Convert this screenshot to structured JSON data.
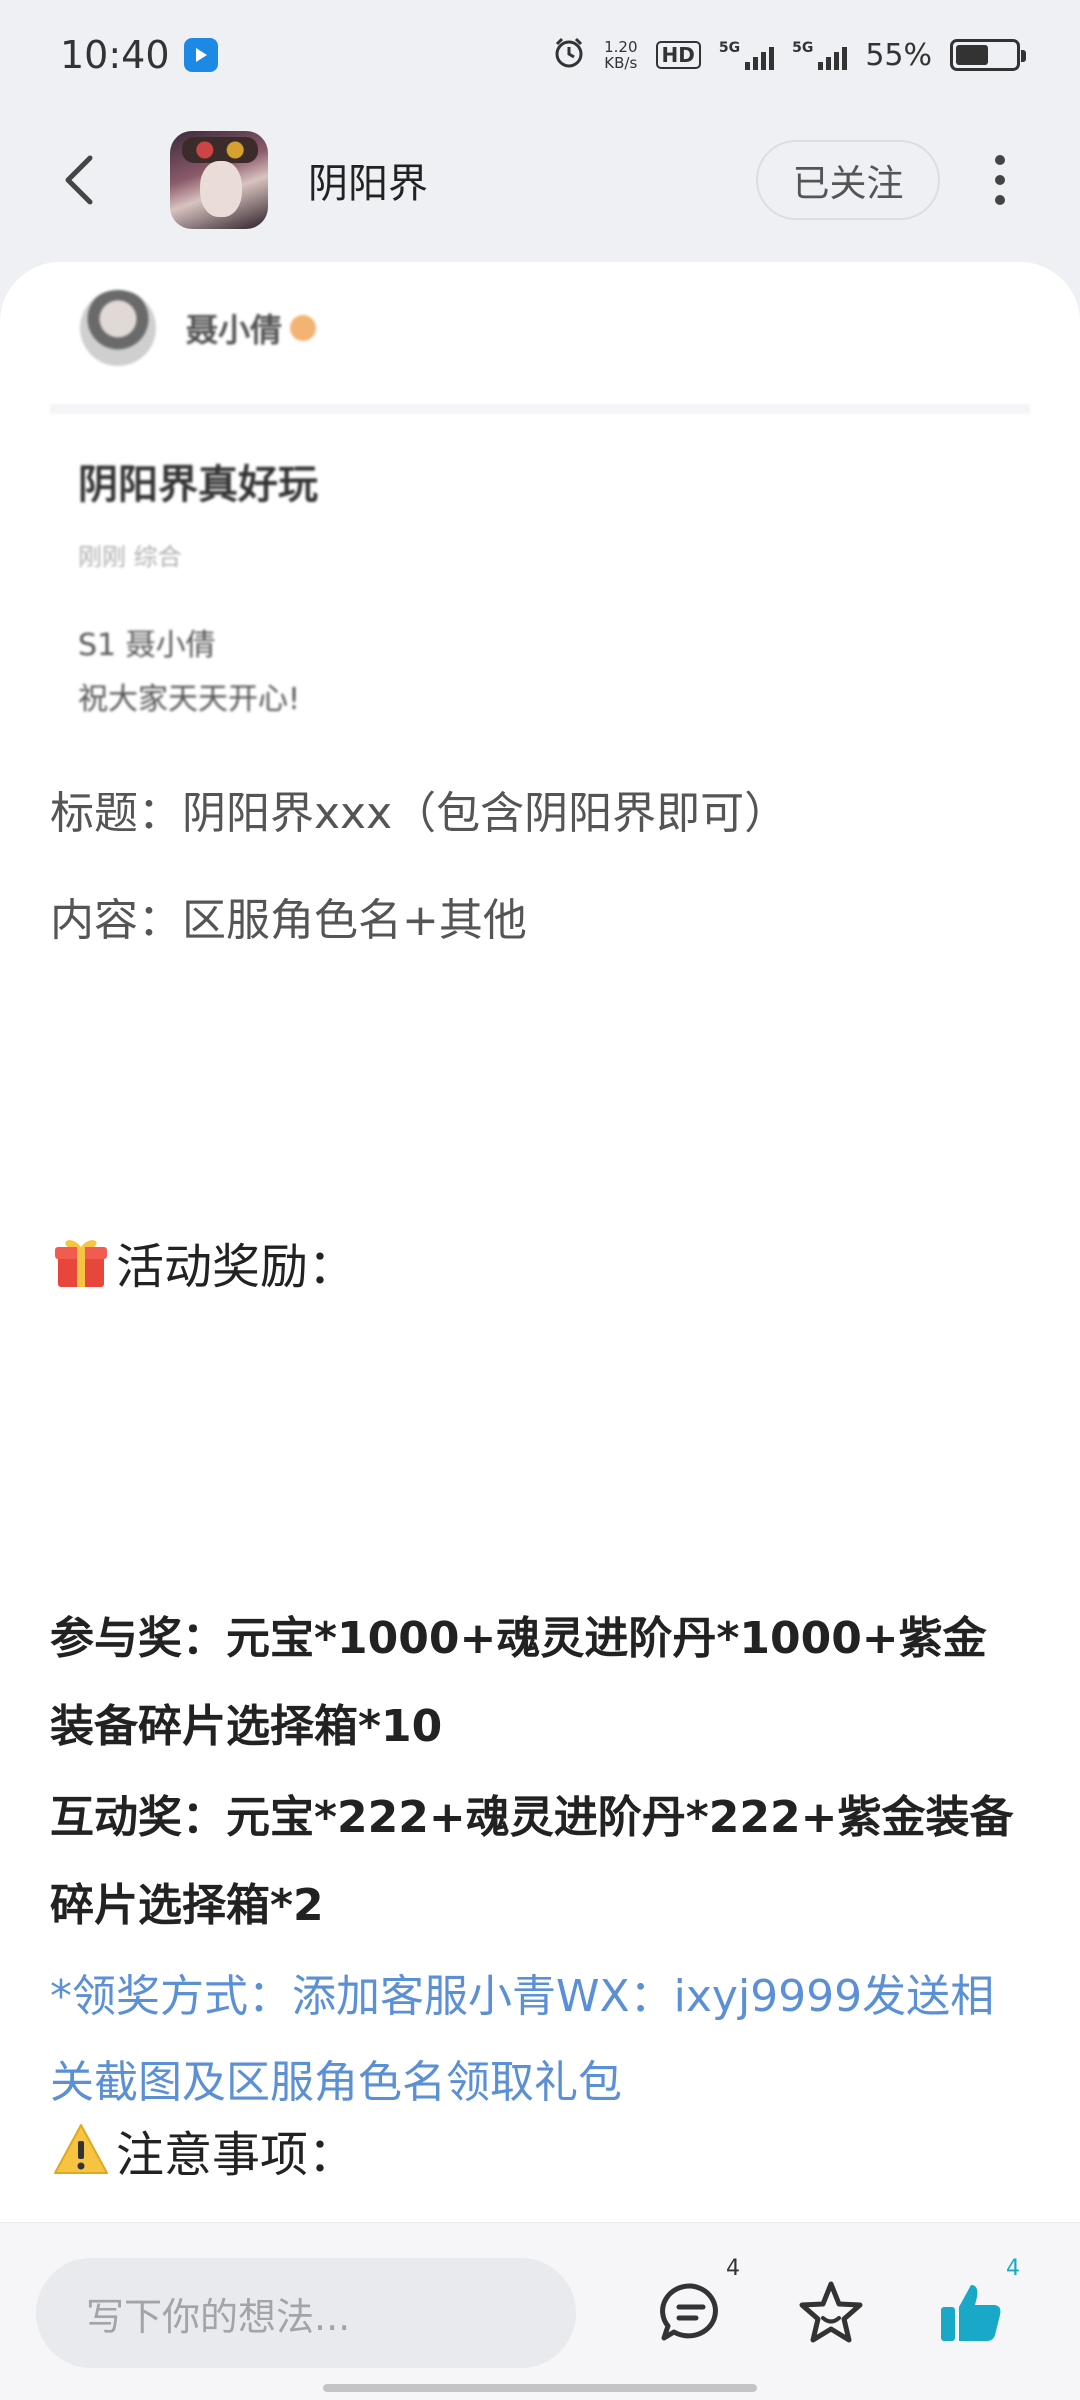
{
  "status_bar": {
    "time": "10:40",
    "net_speed_value": "1.20",
    "net_speed_unit": "KB/s",
    "hd_label": "HD",
    "signal_1_label": "5G",
    "signal_2_label": "5G",
    "battery_percent": "55%",
    "battery_level": 0.55
  },
  "nav": {
    "title": "阴阳界",
    "follow_label": "已关注"
  },
  "embedded_screenshot": {
    "author_name": "聂小倩",
    "post_title": "阴阳界真好玩",
    "meta": "刚刚  综合",
    "line1": "S1 聂小倩",
    "line2": "祝大家天天开心!"
  },
  "post": {
    "title_requirement": "标题：阴阳界xxx（包含阴阳界即可）",
    "content_requirement": "内容：区服角色名+其他",
    "rewards_heading": "活动奖励：",
    "participation_reward": "参与奖：元宝*1000+魂灵进阶丹*1000+紫金装备碎片选择箱*10",
    "interaction_reward": "互动奖：元宝*222+魂灵进阶丹*222+紫金装备碎片选择箱*2",
    "claim_method": "*领奖方式：添加客服小青WX：ixyj9999发送相关截图及区服角色名领取礼包",
    "notice_heading": "注意事项："
  },
  "bottom_bar": {
    "comment_placeholder": "写下你的想法...",
    "comment_count": "4",
    "like_count": "4"
  },
  "colors": {
    "accent_blue": "#5b8fd6",
    "like_teal": "#1aa8c9",
    "background": "#eef0f4"
  }
}
